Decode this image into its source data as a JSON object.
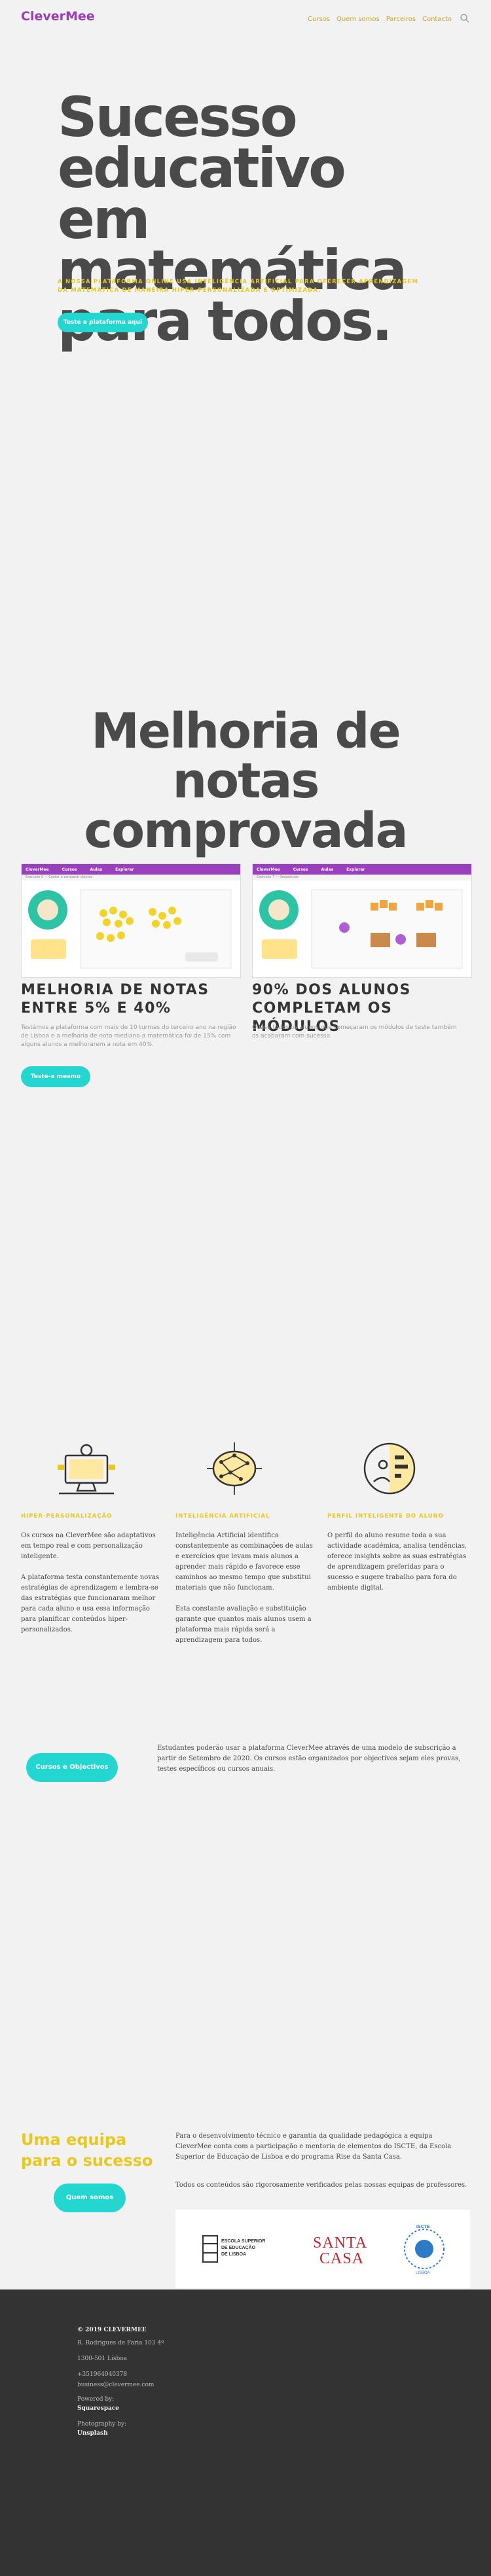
{
  "header": {
    "logo": "CleverMee",
    "nav": [
      "Cursos",
      "Quem somos",
      "Parceiros",
      "Contacto"
    ]
  },
  "hero": {
    "title": "Sucesso educativo em matemática para todos.",
    "subtitle": "A nossa plataforma online usa inteligência artificial para oferecer aprendizagem da matemática de maneira hiper-personalizada e optimizada.",
    "button": "Teste a plataforma aqui"
  },
  "results": {
    "title": "Melhoria de notas comprovada",
    "cards": [
      {
        "title": "Melhoria de notas entre 5% e 40%",
        "text": "Testámos a plataforma com mais de 10 turmas do terceiro ano na região de Lisboa e a melhoria de nota mediana a matemática foi de 15% com alguns alunos a melhorarem a nota em 40%.",
        "screenshot": {
          "app": "CleverMee",
          "tabs": [
            "Cursos",
            "Aulas",
            "Explorar"
          ],
          "crumb": "Exercício 5 — Contar e comparar objetos"
        }
      },
      {
        "title": "90% dos alunos completam os módulos",
        "text": "Quase todos os alunos que começaram os módulos de teste também os acabaram com sucesso.",
        "screenshot": {
          "app": "CleverMee",
          "tabs": [
            "Cursos",
            "Aulas",
            "Explorar"
          ],
          "crumb": "Exercício 7 — Sequências"
        }
      }
    ],
    "button": "Teste-a mesmo"
  },
  "features": [
    {
      "icon": "computer-learner-icon",
      "heading": "Hiper-personalização",
      "paragraphs": [
        "Os cursos na CleverMee são adaptativos em tempo real e com personalização inteligente.",
        "A plataforma testa constantemente novas estratégias de aprendizagem e lembra-se das estratégias que funcionaram melhor para cada aluno e usa essa informação para planificar conteúdos hiper-personalizados."
      ]
    },
    {
      "icon": "neural-brain-icon",
      "heading": "Inteligência artificial",
      "paragraphs": [
        "Inteligência Artificial identifica constantemente as combinações de aulas e exercícios que levam mais alunos a aprender mais rápido e favorece esse caminhos ao mesmo tempo que substitui materiais que não funcionam.",
        "Esta constante avaliação e substituição garante que quantos mais alunos usem a plataforma mais rápida será a aprendizagem para todos."
      ]
    },
    {
      "icon": "student-profile-icon",
      "heading": "Perfil inteligente do aluno",
      "paragraphs": [
        "O perfil do aluno resume toda a sua actividade académica, analisa tendências, oferece insights sobre as suas estratégias de aprendizagem preferidas para o sucesso e sugere trabalho para fora do ambiente digital."
      ]
    }
  ],
  "courses": {
    "button": "Cursos e Objectivos",
    "text": "Estudantes poderão usar a plataforma CleverMee através de uma modelo de subscrição a partir de Setembro de 2020. Os cursos estão organizados por objectivos sejam eles provas, testes específicos ou cursos anuais."
  },
  "team": {
    "title": "Uma equipa para o sucesso",
    "button": "Quem somos",
    "p1": "Para o desenvolvimento técnico e garantia da qualidade pedagógica a equipa CleverMee conta com a participação e mentoria de elementos do ISCTE, da Escola Superior de Educação de Lisboa e do programa Rise da Santa Casa.",
    "p2": "Todos os conteúdos são rigorosamente verificados pelas nossas equipas de professores.",
    "logos": {
      "eselx": [
        "ESCOLA SUPERIOR",
        "DE EDUCAÇÃO",
        "DE LISBOA"
      ],
      "santacasa": [
        "SANTA",
        "CASA"
      ],
      "iscte": [
        "ISCTE",
        "LISBOA"
      ]
    }
  },
  "footer": {
    "copyright": "© 2019 CLEVERMEE",
    "address1": "R. Rodrigues de Faria 103 4º",
    "address2": "1300-501 Lisboa",
    "phone": "+351964940378",
    "email": "business@clevermee.com",
    "powered_label": "Powered by:",
    "powered_value": "Squarespace",
    "photo_label": "Photography by:",
    "photo_value": "Unsplash"
  },
  "colors": {
    "brand_purple": "#9b3db8",
    "accent_yellow": "#e8c81e",
    "accent_teal": "#24d6d0",
    "footer_bg": "#333333"
  }
}
